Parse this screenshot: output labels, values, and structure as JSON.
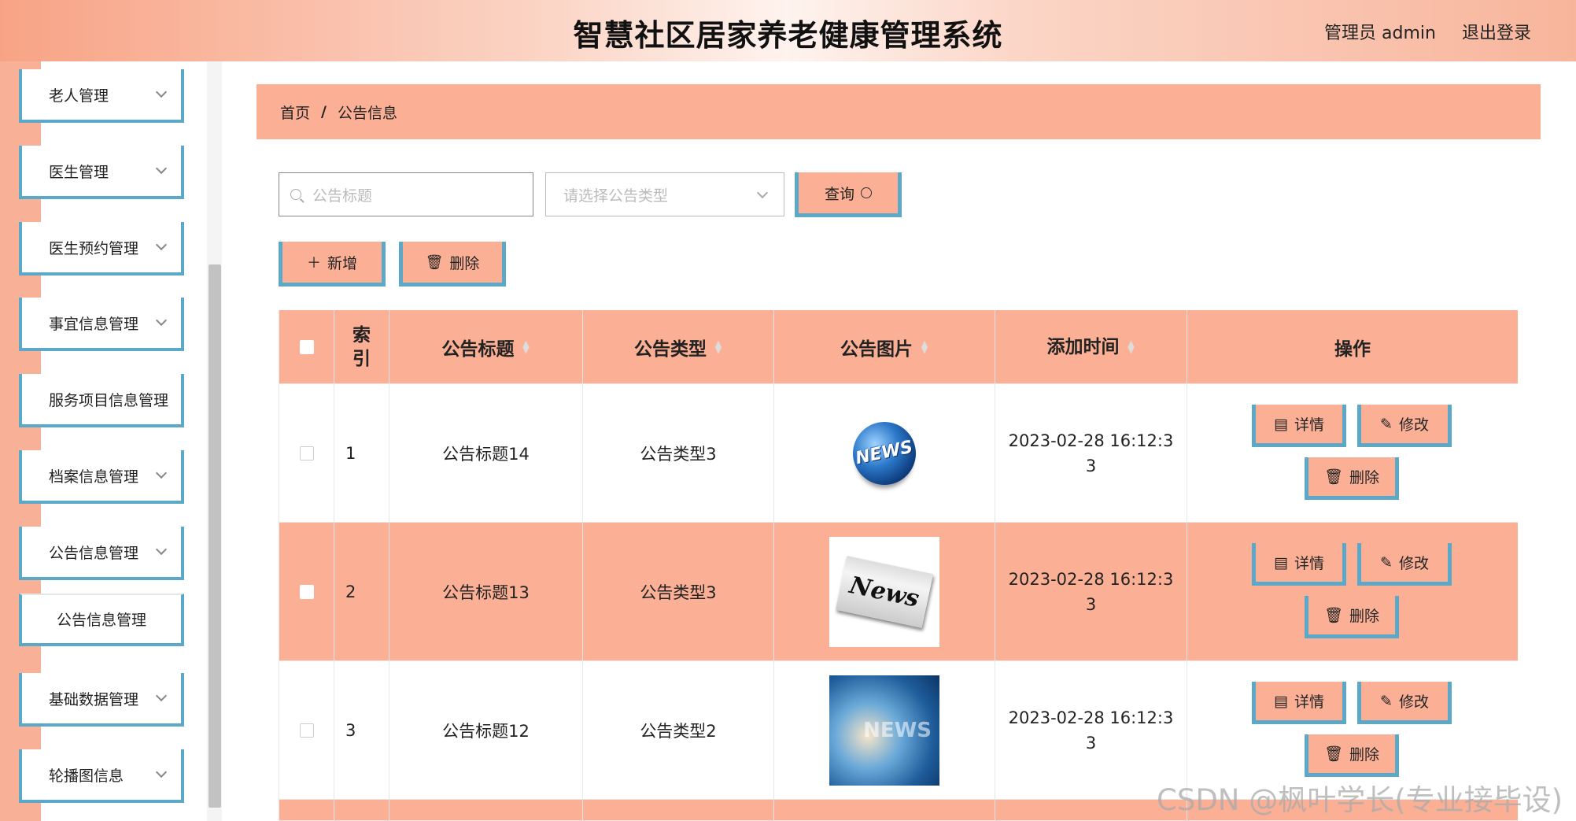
{
  "header": {
    "title": "智慧社区居家养老健康管理系统",
    "user": "管理员 admin",
    "logout": "退出登录"
  },
  "sidebar": {
    "items": [
      {
        "label": "老人管理",
        "has_chevron": true
      },
      {
        "label": "医生管理",
        "has_chevron": true
      },
      {
        "label": "医生预约管理",
        "has_chevron": true
      },
      {
        "label": "事宜信息管理",
        "has_chevron": true
      },
      {
        "label": "服务项目信息管理",
        "has_chevron": false
      },
      {
        "label": "档案信息管理",
        "has_chevron": true
      },
      {
        "label": "公告信息管理",
        "has_chevron": true
      },
      {
        "label": "公告信息管理",
        "has_chevron": false
      },
      {
        "label": "基础数据管理",
        "has_chevron": true
      },
      {
        "label": "轮播图信息",
        "has_chevron": true
      }
    ]
  },
  "breadcrumb": {
    "home": "首页",
    "separator": "/",
    "current": "公告信息"
  },
  "search": {
    "title_placeholder": "公告标题",
    "type_placeholder": "请选择公告类型",
    "query_label": "查询"
  },
  "actions": {
    "add_label": "新增",
    "delete_label": "删除"
  },
  "table": {
    "headers": {
      "index": [
        "索",
        "引"
      ],
      "title": "公告标题",
      "type": "公告类型",
      "image": "公告图片",
      "time": "添加时间",
      "ops": "操作"
    },
    "rows": [
      {
        "index": "1",
        "title": "公告标题14",
        "type": "公告类型3",
        "image": "news-globe",
        "time1": "2023-02-28 16:12:3",
        "time2": "3"
      },
      {
        "index": "2",
        "title": "公告标题13",
        "type": "公告类型3",
        "image": "news-paper",
        "time1": "2023-02-28 16:12:3",
        "time2": "3"
      },
      {
        "index": "3",
        "title": "公告标题12",
        "type": "公告类型2",
        "image": "news-blue",
        "time1": "2023-02-28 16:12:3",
        "time2": "3"
      }
    ],
    "row_ops": {
      "detail": "详情",
      "edit": "修改",
      "delete": "删除"
    }
  },
  "image_text": {
    "globe": "NEWS",
    "paper": "News",
    "blue": "NEWS"
  },
  "watermark": "CSDN @枫叶学长(专业接毕设)",
  "colors": {
    "accent": "#fbb096",
    "border_blue": "#5ba8c9"
  }
}
